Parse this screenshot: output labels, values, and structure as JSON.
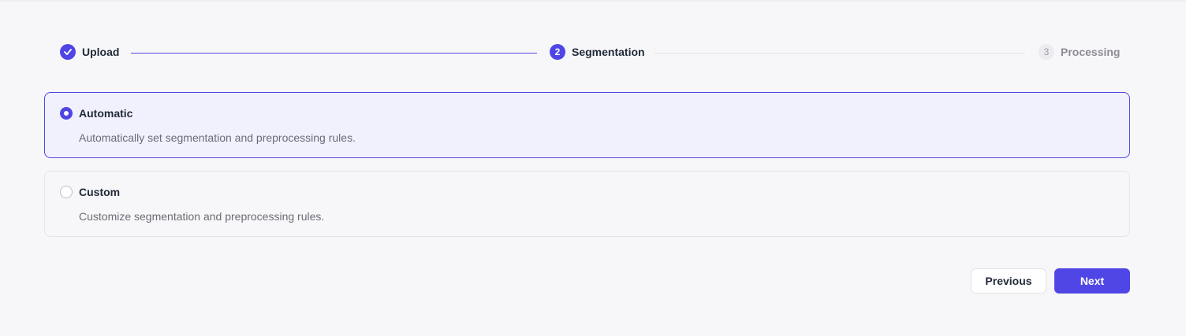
{
  "stepper": {
    "steps": [
      {
        "number": "1",
        "label": "Upload",
        "status": "done",
        "icon": "check-icon"
      },
      {
        "number": "2",
        "label": "Segmentation",
        "status": "active"
      },
      {
        "number": "3",
        "label": "Processing",
        "status": "pending"
      }
    ]
  },
  "options": [
    {
      "title": "Automatic",
      "description": "Automatically set segmentation and preprocessing rules.",
      "selected": true
    },
    {
      "title": "Custom",
      "description": "Customize segmentation and preprocessing rules.",
      "selected": false
    }
  ],
  "actions": {
    "previous_label": "Previous",
    "next_label": "Next"
  },
  "colors": {
    "accent": "#4f46e5",
    "background": "#f7f7f9",
    "selected_bg": "#f1f1fd"
  }
}
